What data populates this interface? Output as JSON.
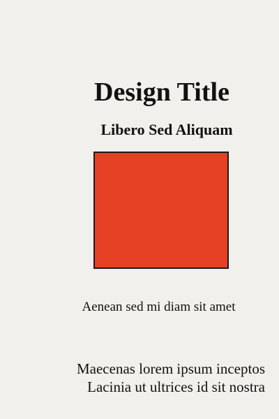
{
  "document": {
    "title": "Design Title",
    "subtitle": "Libero Sed Aliquam",
    "caption": "Aenean sed mi diam sit amet",
    "body_lines": [
      "Maecenas lorem ipsum inceptos",
      "Lacinia ut ultrices id sit nostra"
    ]
  },
  "colors": {
    "background": "#f1f0ec",
    "accent_square": "#e64024",
    "text": "#111111",
    "border": "#1a1a1a"
  }
}
